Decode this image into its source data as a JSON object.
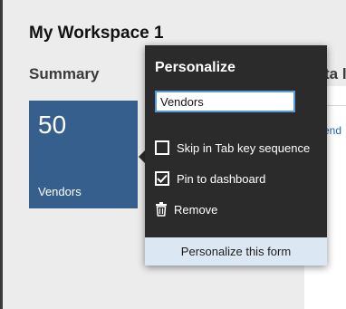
{
  "workspace": {
    "title": "My Workspace 1"
  },
  "summary": {
    "section_title": "Summary",
    "right_section_title": "ta l",
    "right_link": "end"
  },
  "tile": {
    "count": "50",
    "label": "Vendors",
    "color": "#365f8d"
  },
  "popup": {
    "title": "Personalize",
    "name_value": "Vendors",
    "options": [
      {
        "label": "Skip in Tab key sequence",
        "checked": false,
        "icon": "checkbox"
      },
      {
        "label": "Pin to dashboard",
        "checked": true,
        "icon": "checkbox"
      },
      {
        "label": "Remove",
        "icon": "trash-icon"
      }
    ],
    "footer_button": "Personalize this form",
    "background": "#2b2b2b",
    "footer_background": "#dbe7f3"
  }
}
